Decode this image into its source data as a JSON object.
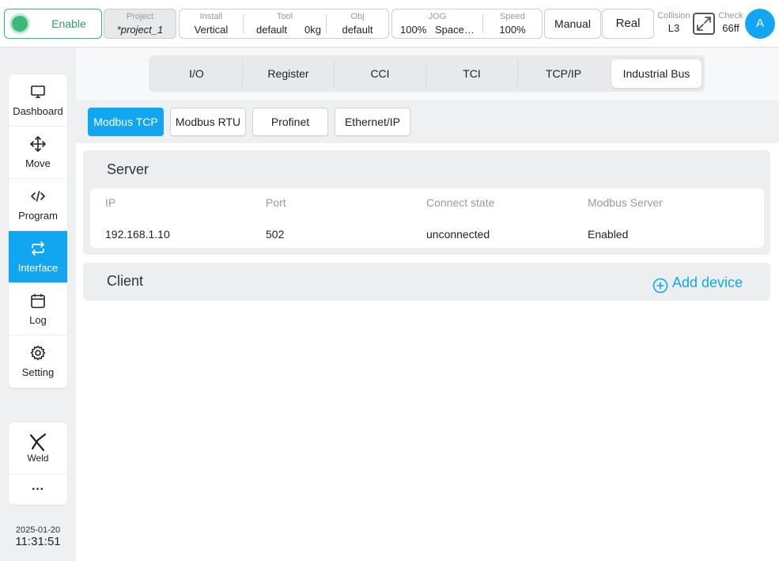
{
  "topbar": {
    "enable_label": "Enable",
    "project": {
      "caption": "Project",
      "value": "*project_1"
    },
    "install": {
      "caption": "Install",
      "value": "Vertical"
    },
    "tool": {
      "caption": "Tool",
      "value": "default",
      "weight": "0kg"
    },
    "obj": {
      "caption": "Obj",
      "value": "default"
    },
    "jog": {
      "caption": "JOG",
      "value": "100%",
      "space": "Space…"
    },
    "speed": {
      "caption": "Speed",
      "value": "100%"
    },
    "manual_label": "Manual",
    "real_label": "Real",
    "collision": {
      "caption": "Collision",
      "value": "L3"
    },
    "check": {
      "caption": "Check",
      "value": "66ff"
    },
    "avatar_letter": "A"
  },
  "sidebar": {
    "items": [
      {
        "label": "Dashboard",
        "icon": "monitor-icon"
      },
      {
        "label": "Move",
        "icon": "move-arrows-icon"
      },
      {
        "label": "Program",
        "icon": "code-icon"
      },
      {
        "label": "Interface",
        "icon": "swap-arrows-icon",
        "active": true
      },
      {
        "label": "Log",
        "icon": "calendar-icon"
      },
      {
        "label": "Setting",
        "icon": "gear-icon"
      }
    ],
    "extra": [
      {
        "label": "Weld",
        "icon": "weld-torch-icon"
      },
      {
        "label": "···",
        "icon": "more-icon"
      }
    ],
    "date": "2025-01-20",
    "time": "11:31:51"
  },
  "tabs": [
    "I/O",
    "Register",
    "CCI",
    "TCI",
    "TCP/IP",
    "Industrial Bus"
  ],
  "active_tab": "Industrial Bus",
  "subtabs": [
    "Modbus TCP",
    "Modbus RTU",
    "Profinet",
    "Ethernet/IP"
  ],
  "active_subtab": "Modbus TCP",
  "server": {
    "title": "Server",
    "columns": [
      "IP",
      "Port",
      "Connect state",
      "Modbus Server"
    ],
    "row": [
      "192.168.1.10",
      "502",
      "unconnected",
      "Enabled"
    ]
  },
  "client": {
    "title": "Client",
    "add_label": "Add device"
  },
  "colors": {
    "accent": "#12a6f0",
    "enable_green": "#3cb878"
  }
}
